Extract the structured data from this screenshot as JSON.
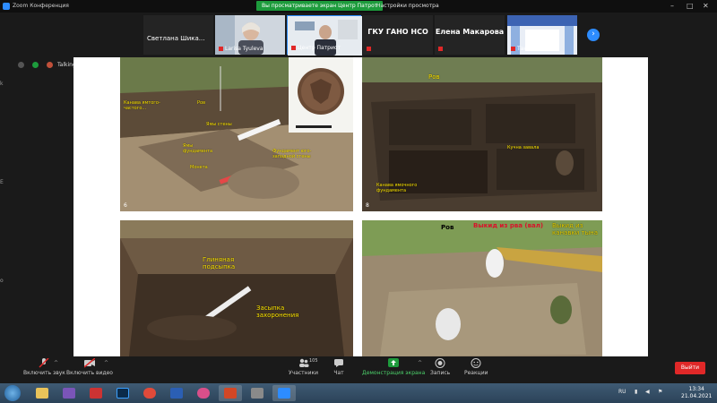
{
  "window": {
    "title": "Zoom Конференция",
    "share_banner": "Вы просматриваете экран Центр Патрот",
    "view_options": "Настройки просмотра"
  },
  "participants": [
    {
      "name": "Светлана  Шика..."
    },
    {
      "name": "Larisa Tyuleva"
    },
    {
      "name": "Центр Патриот"
    },
    {
      "name": "ГКУ ГАНО НСО"
    },
    {
      "name": "Елена Макарова"
    },
    {
      "name": "Таня"
    }
  ],
  "meeting_info": {
    "label": "Talking"
  },
  "slide": {
    "photo1": {
      "number": "6",
      "labels": [
        "Канава ямтого-частого...",
        "Ямы фундамента",
        "Ямы стены",
        "Монета",
        "Фундамент юго-западной стены",
        "Ров"
      ]
    },
    "photo2": {
      "number": "8",
      "labels": [
        "Ров",
        "Канава ямочного фундамента",
        "Кучна завала"
      ]
    },
    "photo3": {
      "labels": [
        "Глиняная подсыпка",
        "Засыпка захоронения"
      ]
    },
    "photo4": {
      "labels": [
        "Ров",
        "Выкид из рва (вал)",
        "Выкид из канавки тына"
      ]
    }
  },
  "controls": {
    "mute_label": "Включить звук",
    "video_label": "Включить видео",
    "participants_label": "Участники",
    "participants_count": "105",
    "chat_label": "Чат",
    "share_label": "Демонстрация экрана",
    "record_label": "Запись",
    "reactions_label": "Реакции",
    "leave_label": "Выйти"
  },
  "taskbar": {
    "lang": "RU",
    "time": "13:34",
    "date": "21.04.2021"
  },
  "colors": {
    "zoom_blue": "#2d8cff",
    "share_green": "#1d9b3c",
    "leave_red": "#e02828",
    "label_yellow": "#ffe600"
  }
}
